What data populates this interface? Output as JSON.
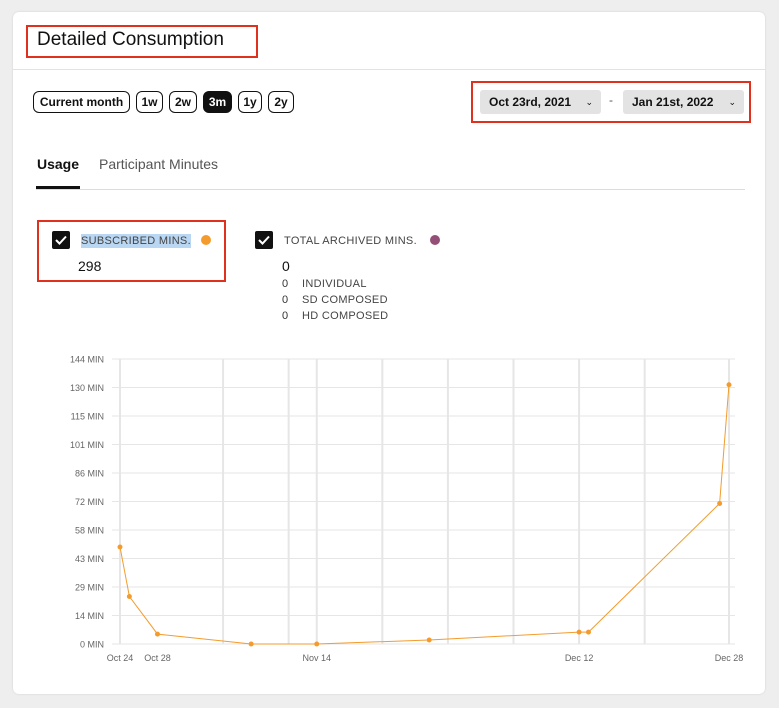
{
  "header": {
    "title": "Detailed Consumption"
  },
  "range_buttons": [
    {
      "label": "Current month",
      "active": false
    },
    {
      "label": "1w",
      "active": false
    },
    {
      "label": "2w",
      "active": false
    },
    {
      "label": "3m",
      "active": true
    },
    {
      "label": "1y",
      "active": false
    },
    {
      "label": "2y",
      "active": false
    }
  ],
  "date_range": {
    "start": "Oct 23rd, 2021",
    "end": "Jan 21st, 2022",
    "separator": "-",
    "chevron_icon": "chevron-down-icon"
  },
  "tabs": [
    {
      "label": "Usage",
      "active": true
    },
    {
      "label": "Participant Minutes",
      "active": false
    }
  ],
  "legend": {
    "subscribed": {
      "label": "SUBSCRIBED MINS.",
      "value": "298",
      "checked": true,
      "color": "#f39c2d"
    },
    "archived": {
      "label": "TOTAL ARCHIVED MINS.",
      "value": "0",
      "checked": true,
      "color": "#944f78",
      "breakdown": [
        {
          "value": "0",
          "label": "INDIVIDUAL"
        },
        {
          "value": "0",
          "label": "SD COMPOSED"
        },
        {
          "value": "0",
          "label": "HD COMPOSED"
        }
      ]
    }
  },
  "chart_data": {
    "type": "line",
    "series": [
      {
        "color": "#f39c2d",
        "points": [
          {
            "x": "2021-10-24",
            "y": 49
          },
          {
            "x": "2021-10-25",
            "y": 24
          },
          {
            "x": "2021-10-28",
            "y": 5
          },
          {
            "x": "2021-11-07",
            "y": 0
          },
          {
            "x": "2021-11-14",
            "y": 0
          },
          {
            "x": "2021-11-26",
            "y": 2
          },
          {
            "x": "2021-12-12",
            "y": 6
          },
          {
            "x": "2021-12-13",
            "y": 6
          },
          {
            "x": "2021-12-27",
            "y": 71
          },
          {
            "x": "2021-12-28",
            "y": 131
          }
        ]
      }
    ],
    "y_ticks": [
      "0 MIN",
      "14 MIN",
      "29 MIN",
      "43 MIN",
      "58 MIN",
      "72 MIN",
      "86 MIN",
      "101 MIN",
      "115 MIN",
      "130 MIN",
      "144 MIN"
    ],
    "y_tick_values": [
      0,
      14.4,
      28.8,
      43.2,
      57.6,
      72,
      86.4,
      100.8,
      115.2,
      129.6,
      144
    ],
    "ylim": [
      0,
      144
    ],
    "x_ticks": [
      {
        "label": "Oct 24",
        "x": "2021-10-24"
      },
      {
        "label": "Oct 28",
        "x": "2021-10-28"
      },
      {
        "label": "Nov 14",
        "x": "2021-11-14"
      },
      {
        "label": "Dec 12",
        "x": "2021-12-12"
      },
      {
        "label": "Dec 28",
        "x": "2021-12-28"
      }
    ],
    "xlim": [
      "2021-10-24",
      "2021-12-28"
    ],
    "vertical_grid": [
      "2021-10-24",
      "2021-11-04",
      "2021-11-11",
      "2021-11-14",
      "2021-11-21",
      "2021-11-28",
      "2021-12-05",
      "2021-12-12",
      "2021-12-19",
      "2021-12-28"
    ],
    "grid": true
  }
}
